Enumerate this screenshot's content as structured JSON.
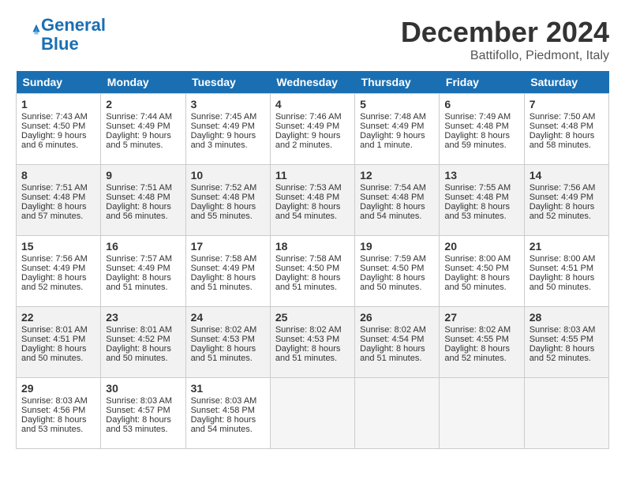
{
  "header": {
    "logo_line1": "General",
    "logo_line2": "Blue",
    "month": "December 2024",
    "location": "Battifollo, Piedmont, Italy"
  },
  "weekdays": [
    "Sunday",
    "Monday",
    "Tuesday",
    "Wednesday",
    "Thursday",
    "Friday",
    "Saturday"
  ],
  "weeks": [
    [
      {
        "day": "1",
        "sunrise": "Sunrise: 7:43 AM",
        "sunset": "Sunset: 4:50 PM",
        "daylight": "Daylight: 9 hours and 6 minutes."
      },
      {
        "day": "2",
        "sunrise": "Sunrise: 7:44 AM",
        "sunset": "Sunset: 4:49 PM",
        "daylight": "Daylight: 9 hours and 5 minutes."
      },
      {
        "day": "3",
        "sunrise": "Sunrise: 7:45 AM",
        "sunset": "Sunset: 4:49 PM",
        "daylight": "Daylight: 9 hours and 3 minutes."
      },
      {
        "day": "4",
        "sunrise": "Sunrise: 7:46 AM",
        "sunset": "Sunset: 4:49 PM",
        "daylight": "Daylight: 9 hours and 2 minutes."
      },
      {
        "day": "5",
        "sunrise": "Sunrise: 7:48 AM",
        "sunset": "Sunset: 4:49 PM",
        "daylight": "Daylight: 9 hours and 1 minute."
      },
      {
        "day": "6",
        "sunrise": "Sunrise: 7:49 AM",
        "sunset": "Sunset: 4:48 PM",
        "daylight": "Daylight: 8 hours and 59 minutes."
      },
      {
        "day": "7",
        "sunrise": "Sunrise: 7:50 AM",
        "sunset": "Sunset: 4:48 PM",
        "daylight": "Daylight: 8 hours and 58 minutes."
      }
    ],
    [
      {
        "day": "8",
        "sunrise": "Sunrise: 7:51 AM",
        "sunset": "Sunset: 4:48 PM",
        "daylight": "Daylight: 8 hours and 57 minutes."
      },
      {
        "day": "9",
        "sunrise": "Sunrise: 7:51 AM",
        "sunset": "Sunset: 4:48 PM",
        "daylight": "Daylight: 8 hours and 56 minutes."
      },
      {
        "day": "10",
        "sunrise": "Sunrise: 7:52 AM",
        "sunset": "Sunset: 4:48 PM",
        "daylight": "Daylight: 8 hours and 55 minutes."
      },
      {
        "day": "11",
        "sunrise": "Sunrise: 7:53 AM",
        "sunset": "Sunset: 4:48 PM",
        "daylight": "Daylight: 8 hours and 54 minutes."
      },
      {
        "day": "12",
        "sunrise": "Sunrise: 7:54 AM",
        "sunset": "Sunset: 4:48 PM",
        "daylight": "Daylight: 8 hours and 54 minutes."
      },
      {
        "day": "13",
        "sunrise": "Sunrise: 7:55 AM",
        "sunset": "Sunset: 4:48 PM",
        "daylight": "Daylight: 8 hours and 53 minutes."
      },
      {
        "day": "14",
        "sunrise": "Sunrise: 7:56 AM",
        "sunset": "Sunset: 4:49 PM",
        "daylight": "Daylight: 8 hours and 52 minutes."
      }
    ],
    [
      {
        "day": "15",
        "sunrise": "Sunrise: 7:56 AM",
        "sunset": "Sunset: 4:49 PM",
        "daylight": "Daylight: 8 hours and 52 minutes."
      },
      {
        "day": "16",
        "sunrise": "Sunrise: 7:57 AM",
        "sunset": "Sunset: 4:49 PM",
        "daylight": "Daylight: 8 hours and 51 minutes."
      },
      {
        "day": "17",
        "sunrise": "Sunrise: 7:58 AM",
        "sunset": "Sunset: 4:49 PM",
        "daylight": "Daylight: 8 hours and 51 minutes."
      },
      {
        "day": "18",
        "sunrise": "Sunrise: 7:58 AM",
        "sunset": "Sunset: 4:50 PM",
        "daylight": "Daylight: 8 hours and 51 minutes."
      },
      {
        "day": "19",
        "sunrise": "Sunrise: 7:59 AM",
        "sunset": "Sunset: 4:50 PM",
        "daylight": "Daylight: 8 hours and 50 minutes."
      },
      {
        "day": "20",
        "sunrise": "Sunrise: 8:00 AM",
        "sunset": "Sunset: 4:50 PM",
        "daylight": "Daylight: 8 hours and 50 minutes."
      },
      {
        "day": "21",
        "sunrise": "Sunrise: 8:00 AM",
        "sunset": "Sunset: 4:51 PM",
        "daylight": "Daylight: 8 hours and 50 minutes."
      }
    ],
    [
      {
        "day": "22",
        "sunrise": "Sunrise: 8:01 AM",
        "sunset": "Sunset: 4:51 PM",
        "daylight": "Daylight: 8 hours and 50 minutes."
      },
      {
        "day": "23",
        "sunrise": "Sunrise: 8:01 AM",
        "sunset": "Sunset: 4:52 PM",
        "daylight": "Daylight: 8 hours and 50 minutes."
      },
      {
        "day": "24",
        "sunrise": "Sunrise: 8:02 AM",
        "sunset": "Sunset: 4:53 PM",
        "daylight": "Daylight: 8 hours and 51 minutes."
      },
      {
        "day": "25",
        "sunrise": "Sunrise: 8:02 AM",
        "sunset": "Sunset: 4:53 PM",
        "daylight": "Daylight: 8 hours and 51 minutes."
      },
      {
        "day": "26",
        "sunrise": "Sunrise: 8:02 AM",
        "sunset": "Sunset: 4:54 PM",
        "daylight": "Daylight: 8 hours and 51 minutes."
      },
      {
        "day": "27",
        "sunrise": "Sunrise: 8:02 AM",
        "sunset": "Sunset: 4:55 PM",
        "daylight": "Daylight: 8 hours and 52 minutes."
      },
      {
        "day": "28",
        "sunrise": "Sunrise: 8:03 AM",
        "sunset": "Sunset: 4:55 PM",
        "daylight": "Daylight: 8 hours and 52 minutes."
      }
    ],
    [
      {
        "day": "29",
        "sunrise": "Sunrise: 8:03 AM",
        "sunset": "Sunset: 4:56 PM",
        "daylight": "Daylight: 8 hours and 53 minutes."
      },
      {
        "day": "30",
        "sunrise": "Sunrise: 8:03 AM",
        "sunset": "Sunset: 4:57 PM",
        "daylight": "Daylight: 8 hours and 53 minutes."
      },
      {
        "day": "31",
        "sunrise": "Sunrise: 8:03 AM",
        "sunset": "Sunset: 4:58 PM",
        "daylight": "Daylight: 8 hours and 54 minutes."
      },
      null,
      null,
      null,
      null
    ]
  ]
}
